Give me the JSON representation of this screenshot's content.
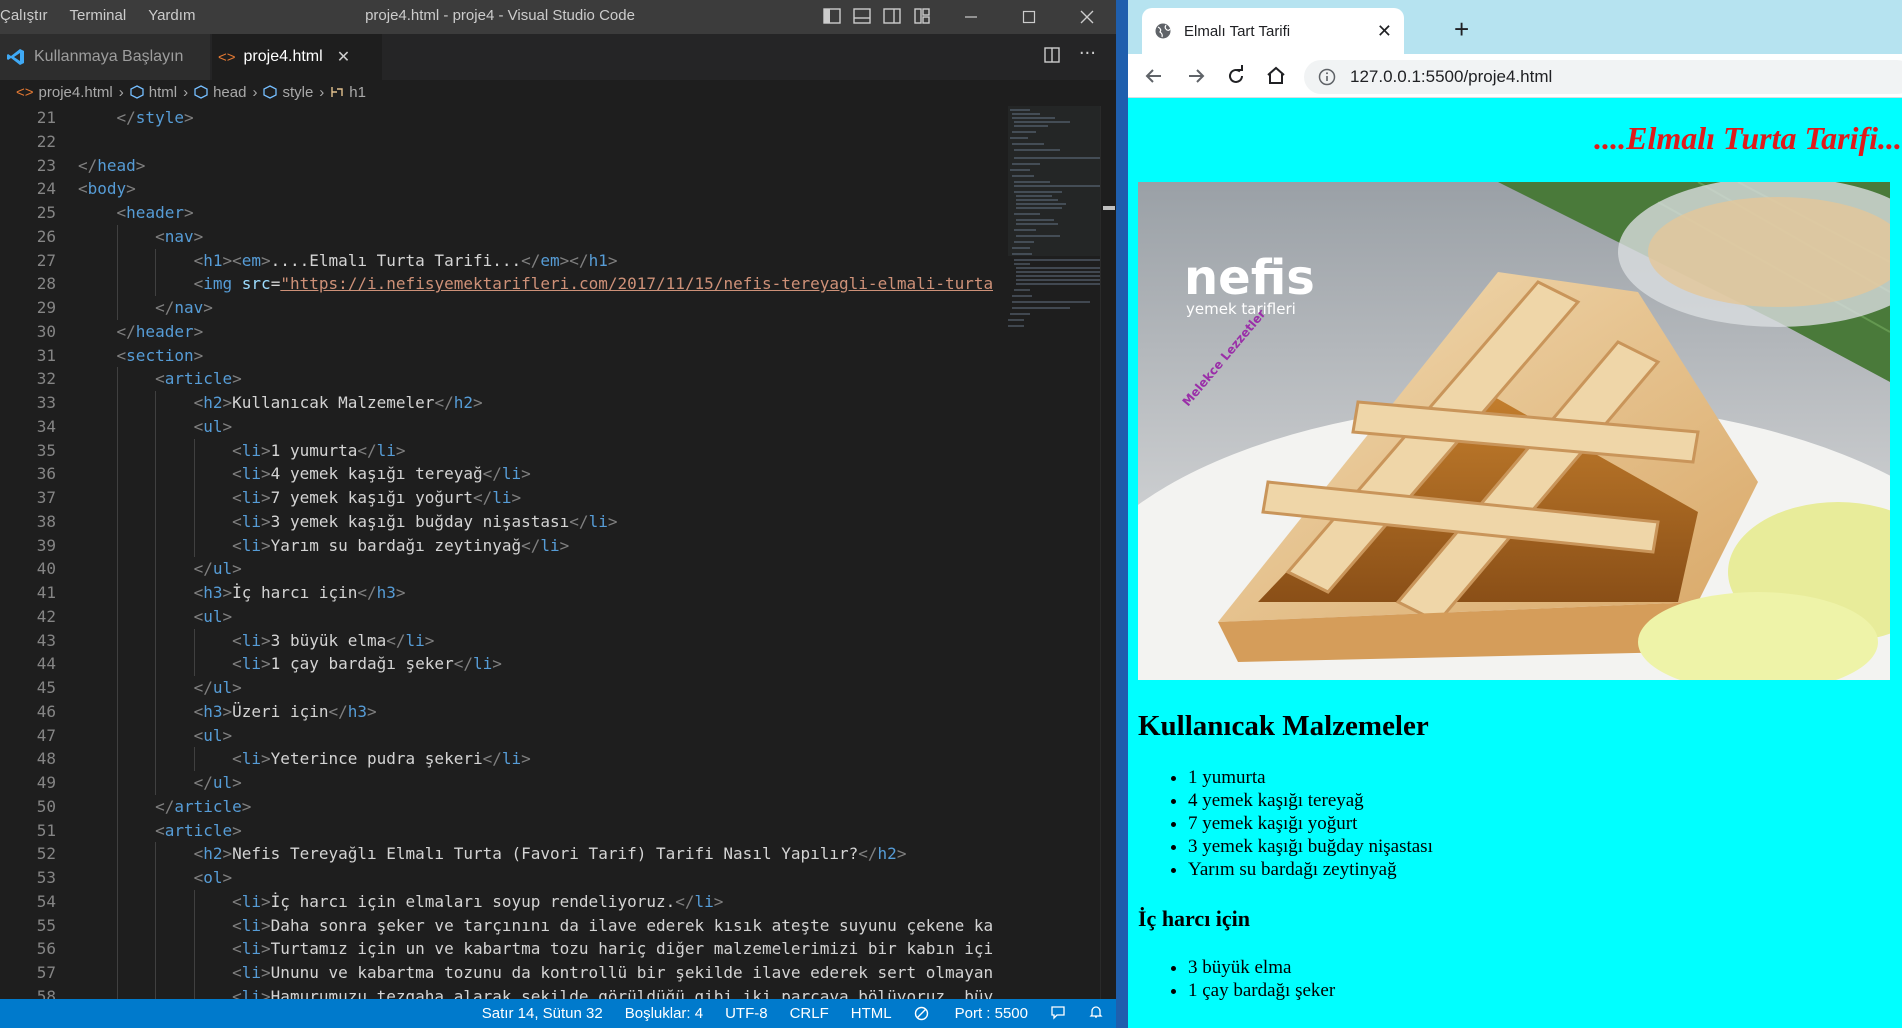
{
  "vscode": {
    "menu": [
      "Çalıştır",
      "Terminal",
      "Yardım"
    ],
    "window_title": "proje4.html - proje4 - Visual Studio Code",
    "tabs": [
      {
        "label": "Kullanmaya Başlayın",
        "icon": "vscode-logo-icon"
      },
      {
        "label": "proje4.html",
        "icon": "html-file-icon"
      }
    ],
    "breadcrumb": [
      "proje4.html",
      "html",
      "head",
      "style",
      "h1"
    ],
    "code_lines": [
      {
        "n": "21",
        "indent": 1,
        "html": "<span class=\"t\">&lt;/</span><span class=\"tn\">style</span><span class=\"t\">&gt;</span>"
      },
      {
        "n": "22",
        "indent": 0,
        "html": ""
      },
      {
        "n": "23",
        "indent": 0,
        "html": "<span class=\"t\">&lt;/</span><span class=\"tn\">head</span><span class=\"t\">&gt;</span>"
      },
      {
        "n": "24",
        "indent": 0,
        "html": "<span class=\"t\">&lt;</span><span class=\"tn\">body</span><span class=\"t\">&gt;</span>"
      },
      {
        "n": "25",
        "indent": 1,
        "html": "<span class=\"t\">&lt;</span><span class=\"tn\">header</span><span class=\"t\">&gt;</span>"
      },
      {
        "n": "26",
        "indent": 2,
        "html": "<span class=\"t\">&lt;</span><span class=\"tn\">nav</span><span class=\"t\">&gt;</span>"
      },
      {
        "n": "27",
        "indent": 3,
        "html": "<span class=\"t\">&lt;</span><span class=\"tn\">h1</span><span class=\"t\">&gt;&lt;</span><span class=\"tn\">em</span><span class=\"t\">&gt;</span>....Elmalı Turta Tarifi...<span class=\"t\">&lt;/</span><span class=\"tn\">em</span><span class=\"t\">&gt;&lt;/</span><span class=\"tn\">h1</span><span class=\"t\">&gt;</span>"
      },
      {
        "n": "28",
        "indent": 3,
        "html": "<span class=\"t\">&lt;</span><span class=\"tn\">img</span> <span class=\"at\">src</span>=<span class=\"sv\">\"https://i.nefisyemektarifleri.com/2017/11/15/nefis-tereyagli-elmali-turta</span>"
      },
      {
        "n": "29",
        "indent": 2,
        "html": "<span class=\"t\">&lt;/</span><span class=\"tn\">nav</span><span class=\"t\">&gt;</span>"
      },
      {
        "n": "30",
        "indent": 1,
        "html": "<span class=\"t\">&lt;/</span><span class=\"tn\">header</span><span class=\"t\">&gt;</span>"
      },
      {
        "n": "31",
        "indent": 1,
        "html": "<span class=\"t\">&lt;</span><span class=\"tn\">section</span><span class=\"t\">&gt;</span>"
      },
      {
        "n": "32",
        "indent": 2,
        "html": "<span class=\"t\">&lt;</span><span class=\"tn\">article</span><span class=\"t\">&gt;</span>"
      },
      {
        "n": "33",
        "indent": 3,
        "html": "<span class=\"t\">&lt;</span><span class=\"tn\">h2</span><span class=\"t\">&gt;</span>Kullanıcak Malzemeler<span class=\"t\">&lt;/</span><span class=\"tn\">h2</span><span class=\"t\">&gt;</span>"
      },
      {
        "n": "34",
        "indent": 3,
        "html": "<span class=\"t\">&lt;</span><span class=\"tn\">ul</span><span class=\"t\">&gt;</span>"
      },
      {
        "n": "35",
        "indent": 4,
        "html": "<span class=\"t\">&lt;</span><span class=\"tn\">li</span><span class=\"t\">&gt;</span>1 yumurta<span class=\"t\">&lt;/</span><span class=\"tn\">li</span><span class=\"t\">&gt;</span>"
      },
      {
        "n": "36",
        "indent": 4,
        "html": "<span class=\"t\">&lt;</span><span class=\"tn\">li</span><span class=\"t\">&gt;</span>4 yemek kaşığı tereyağ<span class=\"t\">&lt;/</span><span class=\"tn\">li</span><span class=\"t\">&gt;</span>"
      },
      {
        "n": "37",
        "indent": 4,
        "html": "<span class=\"t\">&lt;</span><span class=\"tn\">li</span><span class=\"t\">&gt;</span>7 yemek kaşığı yoğurt<span class=\"t\">&lt;/</span><span class=\"tn\">li</span><span class=\"t\">&gt;</span>"
      },
      {
        "n": "38",
        "indent": 4,
        "html": "<span class=\"t\">&lt;</span><span class=\"tn\">li</span><span class=\"t\">&gt;</span>3 yemek kaşığı buğday nişastası<span class=\"t\">&lt;/</span><span class=\"tn\">li</span><span class=\"t\">&gt;</span>"
      },
      {
        "n": "39",
        "indent": 4,
        "html": "<span class=\"t\">&lt;</span><span class=\"tn\">li</span><span class=\"t\">&gt;</span>Yarım su bardağı zeytinyağ<span class=\"t\">&lt;/</span><span class=\"tn\">li</span><span class=\"t\">&gt;</span>"
      },
      {
        "n": "40",
        "indent": 3,
        "html": "<span class=\"t\">&lt;/</span><span class=\"tn\">ul</span><span class=\"t\">&gt;</span>"
      },
      {
        "n": "41",
        "indent": 3,
        "html": "<span class=\"t\">&lt;</span><span class=\"tn\">h3</span><span class=\"t\">&gt;</span>İç harcı için<span class=\"t\">&lt;/</span><span class=\"tn\">h3</span><span class=\"t\">&gt;</span>"
      },
      {
        "n": "42",
        "indent": 3,
        "html": "<span class=\"t\">&lt;</span><span class=\"tn\">ul</span><span class=\"t\">&gt;</span>"
      },
      {
        "n": "43",
        "indent": 4,
        "html": "<span class=\"t\">&lt;</span><span class=\"tn\">li</span><span class=\"t\">&gt;</span>3 büyük elma<span class=\"t\">&lt;/</span><span class=\"tn\">li</span><span class=\"t\">&gt;</span>"
      },
      {
        "n": "44",
        "indent": 4,
        "html": "<span class=\"t\">&lt;</span><span class=\"tn\">li</span><span class=\"t\">&gt;</span>1 çay bardağı şeker<span class=\"t\">&lt;/</span><span class=\"tn\">li</span><span class=\"t\">&gt;</span>"
      },
      {
        "n": "45",
        "indent": 3,
        "html": "<span class=\"t\">&lt;/</span><span class=\"tn\">ul</span><span class=\"t\">&gt;</span>"
      },
      {
        "n": "46",
        "indent": 3,
        "html": "<span class=\"t\">&lt;</span><span class=\"tn\">h3</span><span class=\"t\">&gt;</span>Üzeri için<span class=\"t\">&lt;/</span><span class=\"tn\">h3</span><span class=\"t\">&gt;</span>"
      },
      {
        "n": "47",
        "indent": 3,
        "html": "<span class=\"t\">&lt;</span><span class=\"tn\">ul</span><span class=\"t\">&gt;</span>"
      },
      {
        "n": "48",
        "indent": 4,
        "html": "<span class=\"t\">&lt;</span><span class=\"tn\">li</span><span class=\"t\">&gt;</span>Yeterince pudra şekeri<span class=\"t\">&lt;/</span><span class=\"tn\">li</span><span class=\"t\">&gt;</span>"
      },
      {
        "n": "49",
        "indent": 3,
        "html": "<span class=\"t\">&lt;/</span><span class=\"tn\">ul</span><span class=\"t\">&gt;</span>"
      },
      {
        "n": "50",
        "indent": 2,
        "html": "<span class=\"t\">&lt;/</span><span class=\"tn\">article</span><span class=\"t\">&gt;</span>"
      },
      {
        "n": "51",
        "indent": 2,
        "html": "<span class=\"t\">&lt;</span><span class=\"tn\">article</span><span class=\"t\">&gt;</span>"
      },
      {
        "n": "52",
        "indent": 3,
        "html": "<span class=\"t\">&lt;</span><span class=\"tn\">h2</span><span class=\"t\">&gt;</span>Nefis Tereyağlı Elmalı Turta (Favori Tarif) Tarifi Nasıl Yapılır?<span class=\"t\">&lt;/</span><span class=\"tn\">h2</span><span class=\"t\">&gt;</span>"
      },
      {
        "n": "53",
        "indent": 3,
        "html": "<span class=\"t\">&lt;</span><span class=\"tn\">ol</span><span class=\"t\">&gt;</span>"
      },
      {
        "n": "54",
        "indent": 4,
        "html": "<span class=\"t\">&lt;</span><span class=\"tn\">li</span><span class=\"t\">&gt;</span>İç harcı için elmaları soyup rendeliyoruz.<span class=\"t\">&lt;/</span><span class=\"tn\">li</span><span class=\"t\">&gt;</span>"
      },
      {
        "n": "55",
        "indent": 4,
        "html": "<span class=\"t\">&lt;</span><span class=\"tn\">li</span><span class=\"t\">&gt;</span>Daha sonra şeker ve tarçınını da ilave ederek kısık ateşte suyunu çekene kadar"
      },
      {
        "n": "56",
        "indent": 4,
        "html": "<span class=\"t\">&lt;</span><span class=\"tn\">li</span><span class=\"t\">&gt;</span>Turtamız için un ve kabartma tozu hariç diğer malzemelerimizi bir kabın içine"
      },
      {
        "n": "57",
        "indent": 4,
        "html": "<span class=\"t\">&lt;</span><span class=\"tn\">li</span><span class=\"t\">&gt;</span>Ununu ve kabartma tozunu da kontrollü bir şekilde ilave ederek sert olmayan bir"
      },
      {
        "n": "58",
        "indent": 4,
        "html": "<span class=\"t\">&lt;</span><span class=\"tn\">li</span><span class=\"t\">&gt;</span>Hamurumuzu tezgaha alarak şekilde görüldüğü gibi iki parçaya bölüyoruz. büyük"
      }
    ],
    "status": {
      "position": "Satır 14, Sütun 32",
      "spaces": "Boşluklar: 4",
      "encoding": "UTF-8",
      "eol": "CRLF",
      "language": "HTML",
      "port": "Port : 5500"
    }
  },
  "browser": {
    "tab_title": "Elmalı Tart Tarifi",
    "url": "127.0.0.1:5500/proje4.html",
    "page": {
      "h1": "....Elmalı Turta Tarifi...",
      "image_logo_text": "nefis",
      "image_logo_subtext": "yemek tarifleri",
      "image_watermark": "Melekce Lezzetler",
      "h2": "Kullanıcak Malzemeler",
      "ingredients": [
        "1 yumurta",
        "4 yemek kaşığı tereyağ",
        "7 yemek kaşığı yoğurt",
        "3 yemek kaşığı buğday nişastası",
        "Yarım su bardağı zeytinyağ"
      ],
      "h3": "İç harcı için",
      "filling": [
        "3 büyük elma",
        "1 çay bardağı şeker"
      ]
    }
  }
}
